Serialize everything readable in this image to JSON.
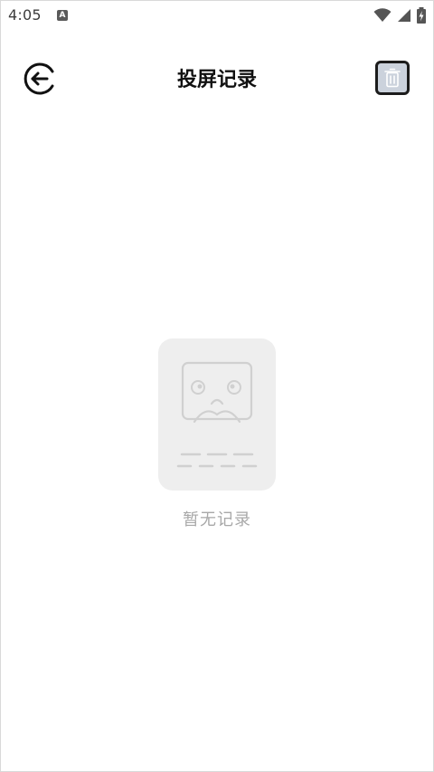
{
  "status_bar": {
    "time": "4:05",
    "notification_icon": "android-a-icon",
    "right_icons": [
      "wifi-icon",
      "signal-icon",
      "battery-charging-icon"
    ]
  },
  "header": {
    "title": "投屏记录",
    "back_icon": "back-arrow-icon",
    "delete_icon": "trash-icon",
    "delete_button_bg": "#cbd2dc"
  },
  "empty_state": {
    "illustration": "sad-face-empty-icon",
    "message": "暂无记录"
  },
  "colors": {
    "title": "#111111",
    "empty_text": "#a8a8a8",
    "empty_card": "#eeeeee"
  }
}
